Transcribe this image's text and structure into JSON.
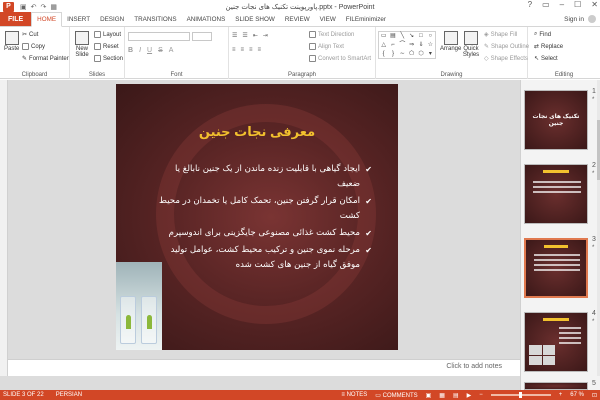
{
  "window": {
    "title": "پاورپوینت تکنیک های نجات جنین.pptx - PowerPoint",
    "controls": [
      "?",
      "▭",
      "–",
      "☐",
      "✕"
    ]
  },
  "tabs": {
    "file": "FILE",
    "items": [
      "HOME",
      "INSERT",
      "DESIGN",
      "TRANSITIONS",
      "ANIMATIONS",
      "SLIDE SHOW",
      "REVIEW",
      "VIEW",
      "FILEminimizer"
    ],
    "active": "HOME",
    "signin": "Sign in"
  },
  "ribbon": {
    "clipboard": {
      "label": "Clipboard",
      "paste": "Paste",
      "cut": "Cut",
      "copy": "Copy",
      "format_painter": "Format Painter"
    },
    "slides": {
      "label": "Slides",
      "new_slide": "New Slide",
      "layout": "Layout",
      "reset": "Reset",
      "section": "Section"
    },
    "font": {
      "label": "Font",
      "font_name": "",
      "font_size": ""
    },
    "paragraph": {
      "label": "Paragraph",
      "text_direction": "Text Direction",
      "align_text": "Align Text",
      "convert_smartart": "Convert to SmartArt"
    },
    "drawing": {
      "label": "Drawing",
      "arrange": "Arrange",
      "quick_styles": "Quick Styles",
      "shape_fill": "Shape Fill",
      "shape_outline": "Shape Outline",
      "shape_effects": "Shape Effects"
    },
    "editing": {
      "label": "Editing",
      "find": "Find",
      "replace": "Replace",
      "select": "Select"
    }
  },
  "slide": {
    "title": "معرفی نجات جنین",
    "bullets": [
      "ایجاد گیاهی با قابلیت زنده ماندن از یک جنین نابالغ یا ضعیف",
      "امکان قرار گرفتن جنین، تحمک کامل یا تخمدان در محیط کشت",
      "محیط کشت غذائی مصنوعی جایگزینی برای اندوسپرم",
      "مرحله نموی جنین و ترکیب محیط کشت، عوامل تولید موفق گیاه از جنین های کشت شده"
    ]
  },
  "notes_hint": "Click to add notes",
  "thumbnails": [
    {
      "num": "1",
      "title": "تکنیک های نجات جنین",
      "selected": false
    },
    {
      "num": "2",
      "title": "",
      "selected": false
    },
    {
      "num": "3",
      "title": "",
      "selected": true
    },
    {
      "num": "4",
      "title": "",
      "selected": false
    },
    {
      "num": "5",
      "title": "",
      "selected": false
    }
  ],
  "status": {
    "slide_info": "SLIDE 3 OF 22",
    "language": "PERSIAN",
    "notes": "NOTES",
    "comments": "COMMENTS",
    "zoom": "67 %",
    "zoom_level": 0.5
  },
  "colors": {
    "accent": "#d24726",
    "slide_title": "#f2c12e"
  }
}
